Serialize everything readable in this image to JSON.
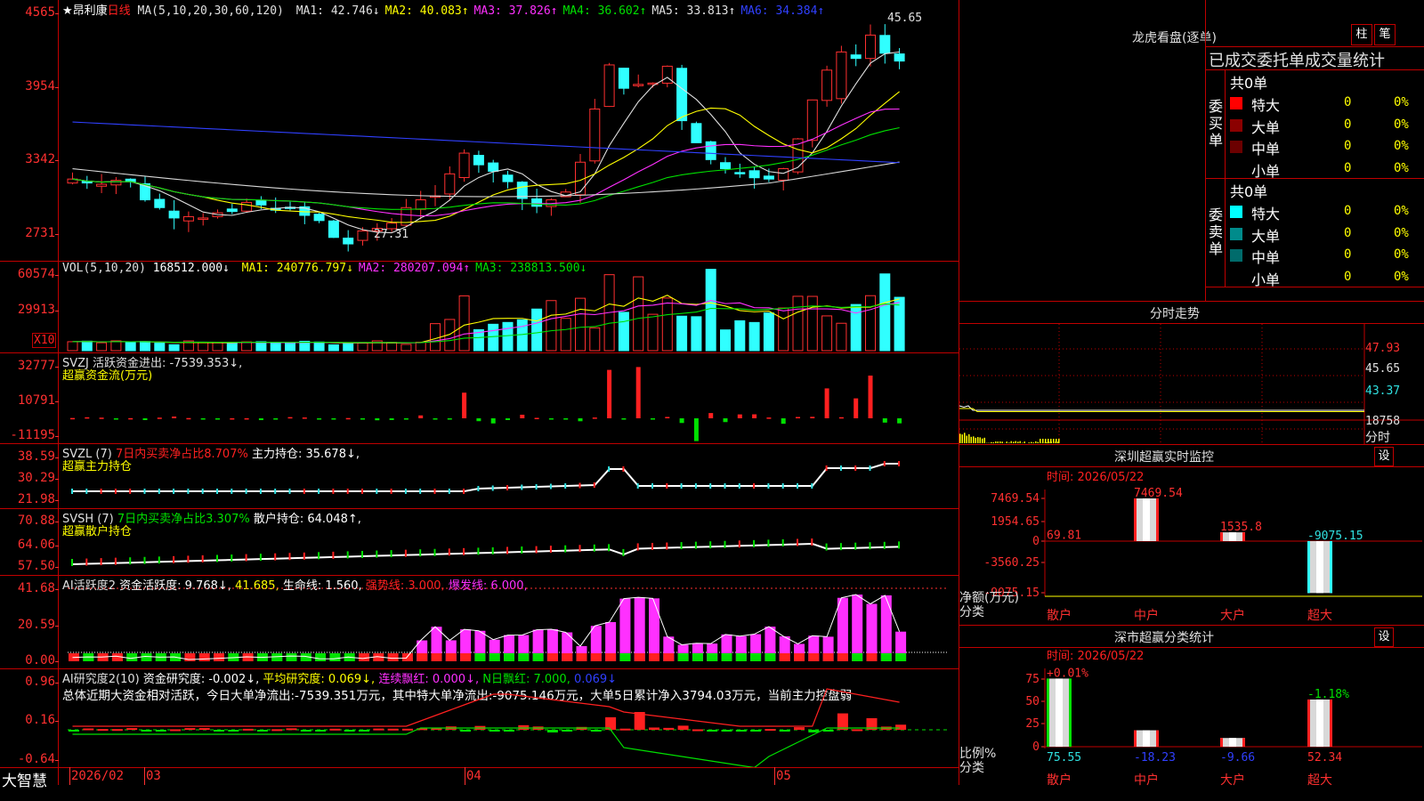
{
  "stock": {
    "name": "★昂利康",
    "period": "日线"
  },
  "price": {
    "ma_label": "MA(5,10,20,30,60,120)",
    "ma": [
      {
        "label": "MA1:",
        "value": "42.746↓",
        "color": "#e0e0e0"
      },
      {
        "label": "MA2:",
        "value": "40.083↑",
        "color": "#ffff00"
      },
      {
        "label": "MA3:",
        "value": "37.826↑",
        "color": "#ff30ff"
      },
      {
        "label": "MA4:",
        "value": "36.602↑",
        "color": "#00e000"
      },
      {
        "label": "MA5:",
        "value": "33.813↑",
        "color": "#e0e0e0"
      },
      {
        "label": "MA6:",
        "value": "34.384↑",
        "color": "#3040ff"
      }
    ],
    "axis": [
      "4565",
      "3954",
      "3342",
      "2731"
    ],
    "high_label": "45.65",
    "low_label": "27.31"
  },
  "volume": {
    "label": "VOL(5,10,20)",
    "value": "168512.000↓",
    "ma": [
      {
        "label": "MA1:",
        "value": "240776.797↓",
        "color": "#ffff00"
      },
      {
        "label": "MA2:",
        "value": "280207.094↑",
        "color": "#ff30ff"
      },
      {
        "label": "MA3:",
        "value": "238813.500↓",
        "color": "#00e000"
      }
    ],
    "axis": [
      "60574",
      "29913"
    ],
    "unit": "X10"
  },
  "svzj": {
    "line1": "SVZJ  活跃资金进出: -7539.353↓,",
    "line2": "超赢资金流(万元)",
    "axis": [
      "32777",
      "10791",
      "-11195"
    ]
  },
  "svzl": {
    "name": "SVZL  (7)",
    "ratio": "7日内买卖净占比8.707%",
    "hold": "主力持仓: 35.678↓,",
    "line2": "超赢主力持仓",
    "axis": [
      "38.59",
      "30.29",
      "21.98"
    ]
  },
  "svsh": {
    "name": "SVSH  (7)",
    "ratio": "7日内买卖净占比3.307%",
    "hold": "散户持仓: 64.048↑,",
    "line2": "超赢散户持仓",
    "axis": [
      "70.88",
      "64.06",
      "57.50"
    ]
  },
  "ai_active": {
    "name": "AI活跃度2",
    "l1": "资金活跃度: 9.768↓,",
    "l2": "41.685,",
    "l3": "生命线: 1.560,",
    "l4": "强势线: 3.000,",
    "l5": "爆发线: 6.000,",
    "axis": [
      "41.68",
      "20.59",
      "0.00"
    ]
  },
  "ai_research": {
    "name": "AI研究度2(10)",
    "l1": "资金研究度: -0.002↓,",
    "l2": "平均研究度: 0.069↓,",
    "l3": "连续飘红: 0.000↓,",
    "l4": "N日飘红: 7.000,",
    "l5": "0.069↓",
    "summary": "总体近期大资金相对活跃，今日大单净流出:-7539.351万元，其中特大单净流出:-9075.146万元，大单5日累计净入3794.03万元，当前主力控盘弱",
    "axis": [
      "0.96",
      "0.16",
      "-0.64"
    ]
  },
  "bottom": {
    "brand": "大智慧",
    "dates": [
      "2026/02",
      "03",
      "04",
      "05"
    ]
  },
  "dragon": {
    "title": "龙虎看盘(逐单)",
    "btn1": "柱",
    "btn2": "笔",
    "header": "已成交委托单成交量统计",
    "buy": {
      "side": "委买单",
      "total": "共0单",
      "rows": [
        {
          "label": "特大",
          "count": "0",
          "pct": "0%",
          "color": "#ff0000"
        },
        {
          "label": "大单",
          "count": "0",
          "pct": "0%",
          "color": "#8b0000"
        },
        {
          "label": "中单",
          "count": "0",
          "pct": "0%",
          "color": "#6b0000"
        },
        {
          "label": "小单",
          "count": "0",
          "pct": "0%",
          "color": "#000000"
        }
      ]
    },
    "sell": {
      "side": "委卖单",
      "total": "共0单",
      "rows": [
        {
          "label": "特大",
          "count": "0",
          "pct": "0%",
          "color": "#00ffff"
        },
        {
          "label": "大单",
          "count": "0",
          "pct": "0%",
          "color": "#008b8b"
        },
        {
          "label": "中单",
          "count": "0",
          "pct": "0%",
          "color": "#006b6b"
        },
        {
          "label": "小单",
          "count": "0",
          "pct": "0%",
          "color": "#000000"
        }
      ]
    }
  },
  "minute": {
    "title": "分时走势",
    "axis": [
      "47.93",
      "45.65",
      "43.37",
      "18758"
    ],
    "unit": "分时"
  },
  "sz_monitor": {
    "title": "深圳超赢实时监控",
    "btn": "设",
    "time": "时间: 2026/05/22",
    "axis": [
      "7469.54",
      "1954.65",
      "0",
      "-3560.25",
      "-9075.15"
    ],
    "ylabel1": "净额(万元)",
    "ylabel2": "分类",
    "cats": [
      "散户",
      "中户",
      "大户",
      "超大"
    ],
    "values": [
      69.81,
      7469.54,
      1535.8,
      -9075.15
    ],
    "labels": [
      "69.81",
      "7469.54",
      "1535.8",
      "-9075.15"
    ]
  },
  "sz_class": {
    "title": "深市超赢分类统计",
    "btn": "设",
    "time": "时间: 2026/05/22",
    "axis": [
      "75",
      "50",
      "25",
      "0"
    ],
    "ylabel1": "比例%",
    "ylabel2": "分类",
    "cats": [
      "散户",
      "中户",
      "大户",
      "超大"
    ],
    "top": [
      "+0.01%",
      "",
      "",
      "-1.18%"
    ],
    "values": [
      75.55,
      18.23,
      9.66,
      52.34
    ],
    "labels": [
      "75.55",
      "-18.23",
      "-9.66",
      "52.34"
    ]
  },
  "chart_data": [
    {
      "type": "candlestick",
      "title": "昂利康 日线",
      "x": [
        "2026/02",
        "03",
        "04",
        "05"
      ],
      "ylim": [
        27.31,
        45.65
      ],
      "approx_close": [
        32.8,
        32.5,
        32.4,
        32.7,
        32.6,
        31.2,
        30.6,
        29.8,
        29.9,
        29.8,
        30.2,
        30.3,
        31.0,
        30.8,
        30.4,
        30.6,
        30.0,
        29.6,
        28.3,
        27.8,
        28.8,
        29.0,
        29.4,
        30.6,
        31.2,
        31.5,
        33.2,
        34.8,
        33.9,
        33.4,
        32.6,
        31.3,
        30.7,
        31.2,
        31.8,
        34.1,
        38.2,
        41.6,
        39.8,
        40.1,
        40.2,
        41.5,
        37.3,
        35.6,
        34.3,
        33.6,
        33.3,
        32.9,
        32.8,
        33.6,
        35.9,
        38.9,
        41.2,
        42.6,
        42.1,
        43.9,
        42.5,
        41.9
      ]
    },
    {
      "type": "bar",
      "title": "VOL(5,10,20)",
      "ylim": [
        0,
        60574
      ]
    }
  ]
}
